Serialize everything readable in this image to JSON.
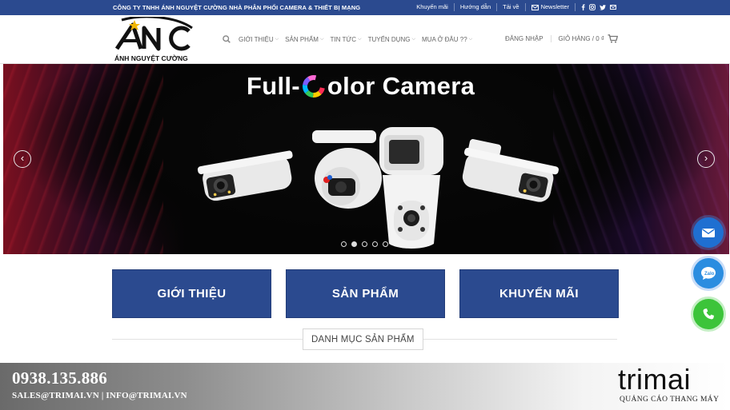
{
  "topbar": {
    "company": "CÔNG TY TNHH ÁNH NGUYỆT CƯỜNG NHÀ PHÂN PHỐI CAMERA & THIẾT BỊ MẠNG",
    "links": [
      "Khuyến mãi",
      "Hướng dẫn",
      "Tải về"
    ],
    "newsletter": "Newsletter",
    "social_icons": [
      "facebook-icon",
      "instagram-icon",
      "twitter-icon",
      "email-icon"
    ]
  },
  "header": {
    "logo_text": "ÁNH NGUYỆT CƯỜNG",
    "logo_mark": "ANC",
    "nav": [
      "GIỚI THIỆU",
      "SẢN PHẨM",
      "TIN TỨC",
      "TUYỂN DỤNG",
      "MUA Ở ĐÂU ??"
    ],
    "login": "ĐĂNG NHẬP",
    "cart": "GIỎ HÀNG / 0 ₫"
  },
  "slider": {
    "headline_left": "Full-",
    "headline_right": "olor Camera",
    "slides_total": 5,
    "active_slide": 2
  },
  "cards": [
    "GIỚI THIỆU",
    "SẢN PHẨM",
    "KHUYẾN MÃI"
  ],
  "category_title": "DANH MỤC SẢN PHẨM",
  "floating_buttons": [
    "email-icon",
    "zalo-icon",
    "phone-icon"
  ],
  "footer": {
    "phone": "0938.135.886",
    "emails": "SALES@TRIMAI.VN | INFO@TRIMAI.VN",
    "brand": "trimai",
    "brand_sub": "QUẢNG CÁO THANG MÁY"
  },
  "colors": {
    "primary_blue": "#2b4a8f",
    "phone_green": "#3cc43a",
    "mail_blue": "#1f6fd1"
  }
}
